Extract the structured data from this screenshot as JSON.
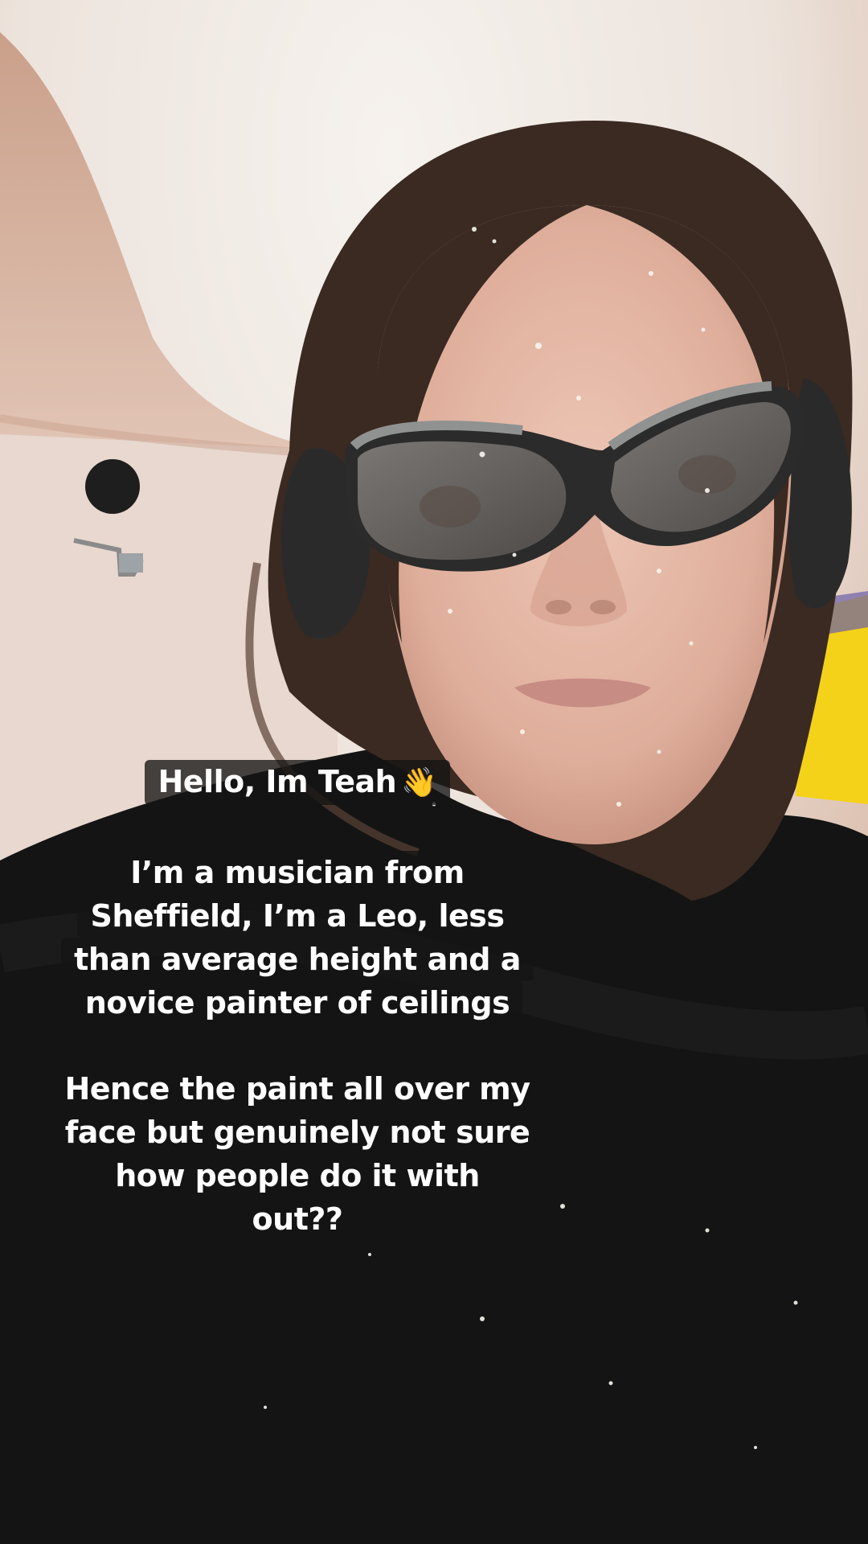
{
  "captions": {
    "intro": {
      "text": "Hello, Im Teah",
      "emoji": "👋"
    },
    "bio": [
      "I’m a musician from",
      "Sheffield, I’m a Leo, less",
      "than average height and a",
      "novice painter of ceilings"
    ],
    "joke": [
      "Hence the paint all over my",
      "face but genuinely not sure",
      "how people do it with",
      "out??"
    ]
  },
  "colors": {
    "ceiling": "#efe7e0",
    "wall_warm": "#d9b39c",
    "sweater": "#141414",
    "skin": "#e3b9a8",
    "hair": "#3a2a22",
    "goggle_frame": "#2b2b2b",
    "goggle_trim": "#8f9291",
    "ear_defender": "#2a2a2a",
    "accent_yellow": "#f5d21a",
    "caption_bg": "#141414",
    "caption_text": "#ffffff"
  }
}
